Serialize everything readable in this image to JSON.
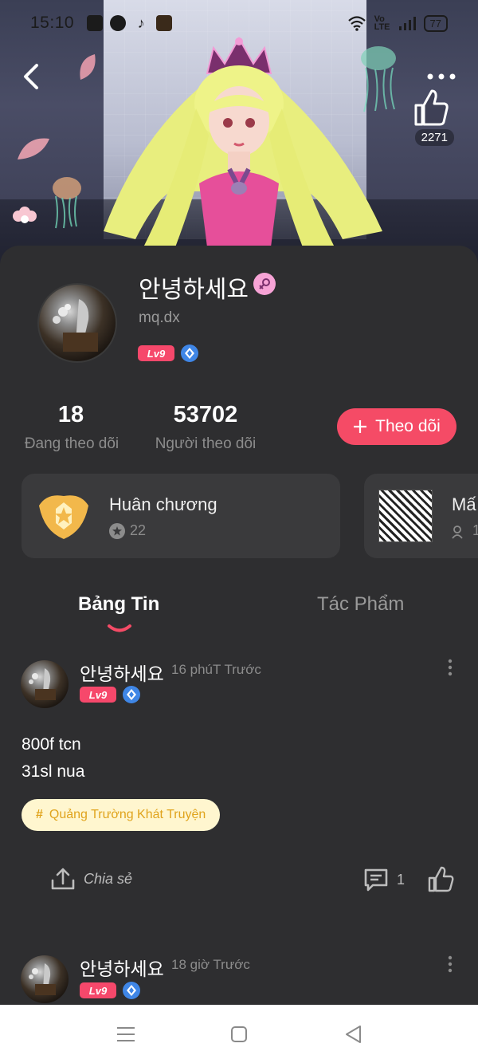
{
  "status_bar": {
    "time": "15:10",
    "battery": "77",
    "icons": [
      "shopping-bag-icon",
      "facebook-icon",
      "tiktok-icon",
      "app-icon",
      "wifi-icon",
      "volte-icon",
      "signal-icon",
      "battery-icon"
    ]
  },
  "banner": {
    "like_count": "2271"
  },
  "profile": {
    "name": "안녕하세요",
    "handle": "mq.dx",
    "level": "Lv9",
    "gender_icon": "female-icon",
    "stats": {
      "following_count": "18",
      "following_label": "Đang theo dõi",
      "followers_count": "53702",
      "followers_label": "Người theo dõi"
    },
    "follow_button": "Theo dõi"
  },
  "cards": {
    "medal_title": "Huân chương",
    "medal_count": "22",
    "manga_title": "Mấ",
    "manga_count": "1"
  },
  "tabs": {
    "feed": "Bảng Tin",
    "works": "Tác Phẩm"
  },
  "posts": [
    {
      "name": "안녕하세요",
      "time": "16 phúT Trước",
      "level": "Lv9",
      "line1": "800f tcn",
      "line2": "31sl nua",
      "tag": "Quảng Trường Khát Truyện",
      "share_label": "Chia sẻ",
      "comment_count": "1"
    },
    {
      "name": "안녕하세요",
      "time": "18 giờ Trước",
      "level": "Lv9"
    }
  ],
  "colors": {
    "accent": "#f54b66",
    "level_badge": "#f6486b",
    "diamond": "#3f86e6",
    "tag_bg": "#fff6cf",
    "tag_text": "#e0a31c"
  }
}
